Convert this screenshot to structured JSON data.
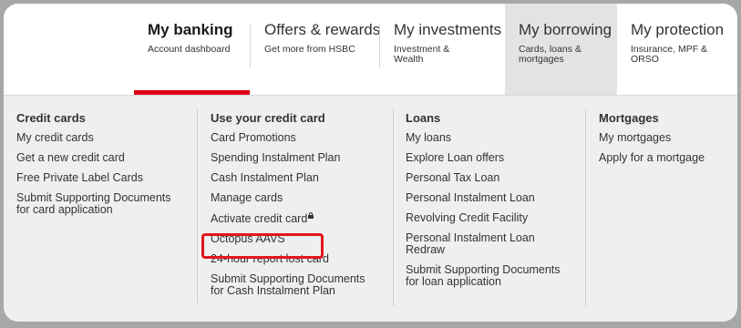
{
  "nav": {
    "tabs": [
      {
        "title": "My banking",
        "sub": "Account dashboard"
      },
      {
        "title": "Offers & rewards",
        "sub": "Get more from HSBC"
      },
      {
        "title": "My investments",
        "sub": "Investment &\nWealth"
      },
      {
        "title": "My borrowing",
        "sub": "Cards, loans &\nmortgages"
      },
      {
        "title": "My protection",
        "sub": "Insurance, MPF &\nORSO"
      }
    ]
  },
  "menu": {
    "credit_cards": {
      "heading": "Credit cards",
      "links": [
        "My credit cards",
        "Get a new credit card",
        "Free Private Label Cards",
        "Submit Supporting Documents\nfor card application"
      ]
    },
    "use_card": {
      "heading": "Use your credit card",
      "links": [
        "Card Promotions",
        "Spending Instalment Plan",
        "Cash Instalment Plan",
        "Manage cards",
        "Activate credit card",
        "Octopus AAVS",
        "24-hour report lost card",
        "Submit Supporting Documents\nfor Cash Instalment Plan"
      ]
    },
    "loans": {
      "heading": "Loans",
      "links": [
        "My loans",
        "Explore Loan offers",
        "Personal Tax Loan",
        "Personal Instalment Loan",
        "Revolving Credit Facility",
        "Personal Instalment Loan\nRedraw",
        "Submit Supporting Documents\nfor loan application"
      ]
    },
    "mortgages": {
      "heading": "Mortgages",
      "links": [
        "My mortgages",
        "Apply for a mortgage"
      ]
    }
  },
  "colors": {
    "accent": "#db0011",
    "highlight": "#e3161b"
  }
}
